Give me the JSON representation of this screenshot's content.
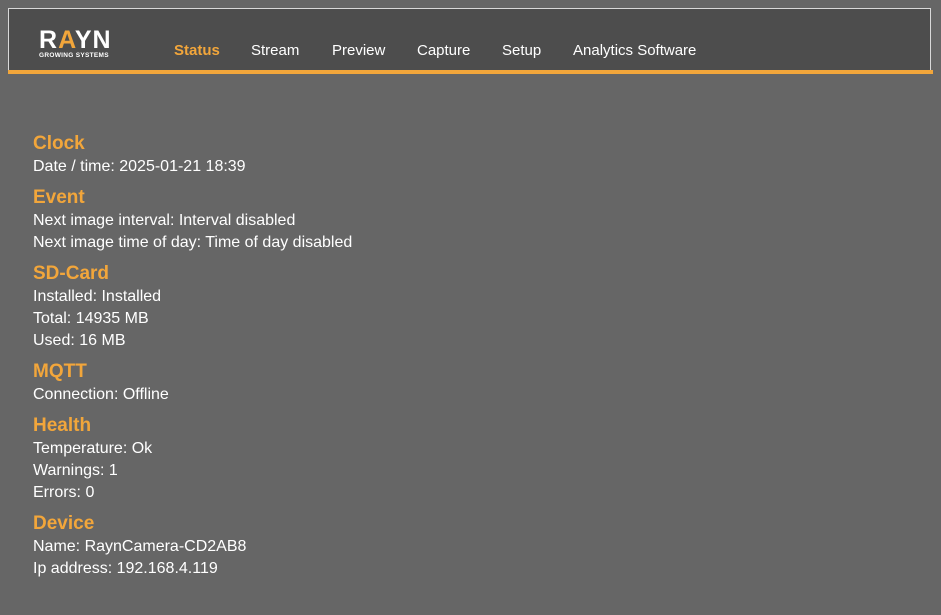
{
  "brand": {
    "name_left": "R",
    "name_accent": "A",
    "name_right": "YN",
    "tagline": "GROWING SYSTEMS",
    "accent_color": "#f2a63b"
  },
  "nav": {
    "items": [
      {
        "label": "Status",
        "active": true
      },
      {
        "label": "Stream",
        "active": false
      },
      {
        "label": "Preview",
        "active": false
      },
      {
        "label": "Capture",
        "active": false
      },
      {
        "label": "Setup",
        "active": false
      },
      {
        "label": "Analytics Software",
        "active": false
      }
    ]
  },
  "sections": {
    "clock": {
      "title": "Clock",
      "rows": [
        "Date / time: 2025-01-21 18:39"
      ]
    },
    "event": {
      "title": "Event",
      "rows": [
        "Next image interval: Interval disabled",
        "Next image time of day: Time of day disabled"
      ]
    },
    "sdcard": {
      "title": "SD-Card",
      "rows": [
        "Installed: Installed",
        "Total: 14935 MB",
        "Used: 16 MB"
      ]
    },
    "mqtt": {
      "title": "MQTT",
      "rows": [
        "Connection: Offline"
      ]
    },
    "health": {
      "title": "Health",
      "rows": [
        "Temperature: Ok",
        "Warnings: 1",
        "Errors: 0"
      ]
    },
    "device": {
      "title": "Device",
      "rows": [
        "Name: RaynCamera-CD2AB8",
        "Ip address: 192.168.4.119"
      ]
    }
  }
}
